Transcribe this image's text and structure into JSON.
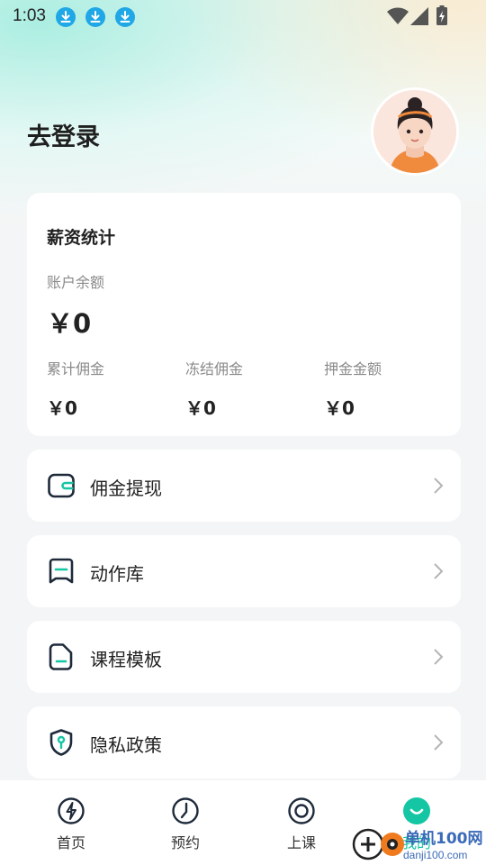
{
  "status_bar": {
    "time": "1:03"
  },
  "header": {
    "login_text": "去登录"
  },
  "salary_card": {
    "title": "薪资统计",
    "balance_label": "账户余额",
    "balance_value": "￥0",
    "stats": [
      {
        "label": "累计佣金",
        "value": "￥0"
      },
      {
        "label": "冻结佣金",
        "value": "￥0"
      },
      {
        "label": "押金金额",
        "value": "￥0"
      }
    ]
  },
  "menu": [
    {
      "label": "佣金提现",
      "icon": "wallet-icon"
    },
    {
      "label": "动作库",
      "icon": "bookmark-icon"
    },
    {
      "label": "课程模板",
      "icon": "document-icon"
    },
    {
      "label": "隐私政策",
      "icon": "shield-icon"
    }
  ],
  "tabs": [
    {
      "label": "首页",
      "icon": "lightning-icon",
      "active": false
    },
    {
      "label": "预约",
      "icon": "clock-icon",
      "active": false
    },
    {
      "label": "上课",
      "icon": "target-icon",
      "active": false
    },
    {
      "label": "我的",
      "icon": "smile-icon",
      "active": true
    }
  ],
  "watermark": {
    "text": "单机100网",
    "url": "danji100.com"
  },
  "colors": {
    "accent": "#14c6a3",
    "download_badge": "#1fa7e6",
    "icon_stroke": "#1e2a3a"
  }
}
